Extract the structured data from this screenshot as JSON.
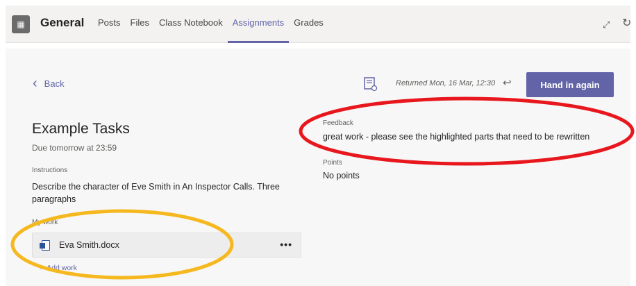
{
  "header": {
    "team_icon": "team-icon",
    "channel_name": "General",
    "tabs": [
      {
        "label": "Posts",
        "active": false
      },
      {
        "label": "Files",
        "active": false
      },
      {
        "label": "Class Notebook",
        "active": false
      },
      {
        "label": "Assignments",
        "active": true
      },
      {
        "label": "Grades",
        "active": false
      }
    ],
    "expand_glyph": "⤢",
    "refresh_glyph": "↻"
  },
  "toolbar": {
    "back_label": "Back",
    "returned_text": "Returned Mon, 16 Mar, 12:30",
    "return_arrow": "↩",
    "hand_in_label": "Hand in again"
  },
  "assignment": {
    "title": "Example Tasks",
    "due": "Due tomorrow at 23:59",
    "instructions_label": "Instructions",
    "instructions": "Describe the character of Eve Smith in An Inspector Calls. Three paragraphs",
    "my_work_label": "My work",
    "file_name": "Eva Smith.docx",
    "more_glyph": "•••",
    "add_work_label": "Add work"
  },
  "feedback": {
    "label": "Feedback",
    "text": "great work - please see the highlighted parts that need to be rewritten",
    "points_label": "Points",
    "points": "No points"
  },
  "colors": {
    "accent": "#6264a7",
    "annotation_red": "#e8171d",
    "annotation_yellow": "#f6b81f"
  }
}
